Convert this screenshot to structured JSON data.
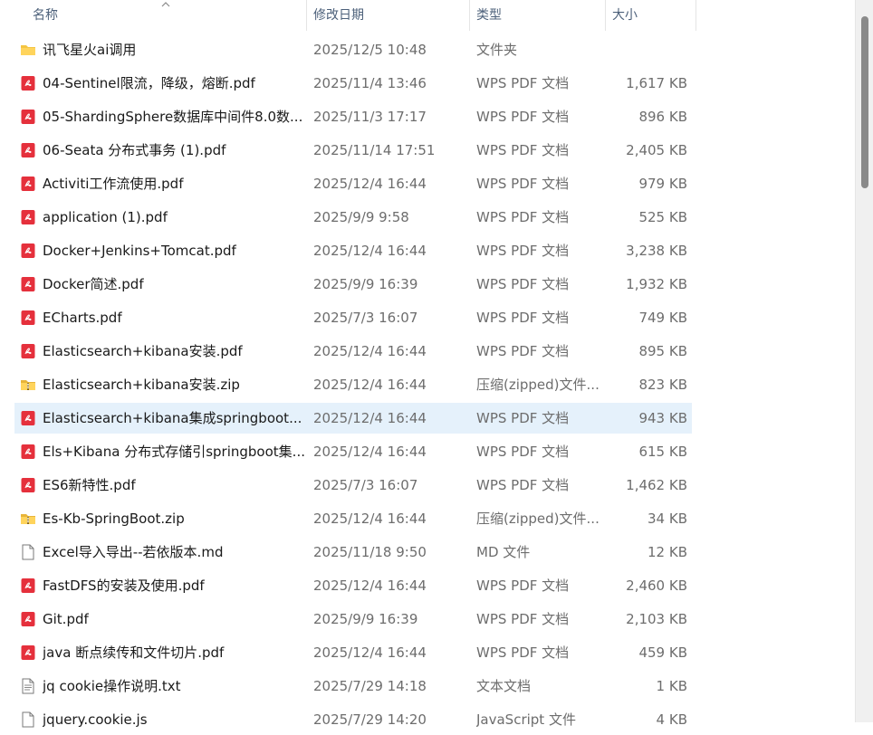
{
  "columns": {
    "name": "名称",
    "date": "修改日期",
    "type": "类型",
    "size": "大小"
  },
  "files": [
    {
      "name": "讯飞星火ai调用",
      "date": "2025/12/5 10:48",
      "type": "文件夹",
      "size": "",
      "icon": "folder-icon"
    },
    {
      "name": "04-Sentinel限流，降级，熔断.pdf",
      "date": "2025/11/4 13:46",
      "type": "WPS PDF 文档",
      "size": "1,617 KB",
      "icon": "pdf-icon"
    },
    {
      "name": "05-ShardingSphere数据库中间件8.0数...",
      "date": "2025/11/3 17:17",
      "type": "WPS PDF 文档",
      "size": "896 KB",
      "icon": "pdf-icon"
    },
    {
      "name": "06-Seata 分布式事务 (1).pdf",
      "date": "2025/11/14 17:51",
      "type": "WPS PDF 文档",
      "size": "2,405 KB",
      "icon": "pdf-icon"
    },
    {
      "name": "Activiti工作流使用.pdf",
      "date": "2025/12/4 16:44",
      "type": "WPS PDF 文档",
      "size": "979 KB",
      "icon": "pdf-icon"
    },
    {
      "name": "application (1).pdf",
      "date": "2025/9/9 9:58",
      "type": "WPS PDF 文档",
      "size": "525 KB",
      "icon": "pdf-icon"
    },
    {
      "name": "Docker+Jenkins+Tomcat.pdf",
      "date": "2025/12/4 16:44",
      "type": "WPS PDF 文档",
      "size": "3,238 KB",
      "icon": "pdf-icon"
    },
    {
      "name": "Docker简述.pdf",
      "date": "2025/9/9 16:39",
      "type": "WPS PDF 文档",
      "size": "1,932 KB",
      "icon": "pdf-icon"
    },
    {
      "name": "ECharts.pdf",
      "date": "2025/7/3 16:07",
      "type": "WPS PDF 文档",
      "size": "749 KB",
      "icon": "pdf-icon"
    },
    {
      "name": "Elasticsearch+kibana安装.pdf",
      "date": "2025/12/4 16:44",
      "type": "WPS PDF 文档",
      "size": "895 KB",
      "icon": "pdf-icon"
    },
    {
      "name": "Elasticsearch+kibana安装.zip",
      "date": "2025/12/4 16:44",
      "type": "压缩(zipped)文件...",
      "size": "823 KB",
      "icon": "zip-icon"
    },
    {
      "name": "Elasticsearch+kibana集成springboot...",
      "date": "2025/12/4 16:44",
      "type": "WPS PDF 文档",
      "size": "943 KB",
      "icon": "pdf-icon",
      "selected": true
    },
    {
      "name": "Els+Kibana 分布式存储引springboot集...",
      "date": "2025/12/4 16:44",
      "type": "WPS PDF 文档",
      "size": "615 KB",
      "icon": "pdf-icon"
    },
    {
      "name": "ES6新特性.pdf",
      "date": "2025/7/3 16:07",
      "type": "WPS PDF 文档",
      "size": "1,462 KB",
      "icon": "pdf-icon"
    },
    {
      "name": "Es-Kb-SpringBoot.zip",
      "date": "2025/12/4 16:44",
      "type": "压缩(zipped)文件...",
      "size": "34 KB",
      "icon": "zip-icon"
    },
    {
      "name": "Excel导入导出--若依版本.md",
      "date": "2025/11/18 9:50",
      "type": "MD 文件",
      "size": "12 KB",
      "icon": "file-icon"
    },
    {
      "name": "FastDFS的安装及使用.pdf",
      "date": "2025/12/4 16:44",
      "type": "WPS PDF 文档",
      "size": "2,460 KB",
      "icon": "pdf-icon"
    },
    {
      "name": "Git.pdf",
      "date": "2025/9/9 16:39",
      "type": "WPS PDF 文档",
      "size": "2,103 KB",
      "icon": "pdf-icon"
    },
    {
      "name": "java 断点续传和文件切片.pdf",
      "date": "2025/12/4 16:44",
      "type": "WPS PDF 文档",
      "size": "459 KB",
      "icon": "pdf-icon"
    },
    {
      "name": "jq cookie操作说明.txt",
      "date": "2025/7/29 14:18",
      "type": "文本文档",
      "size": "1 KB",
      "icon": "txt-icon"
    },
    {
      "name": "jquery.cookie.js",
      "date": "2025/7/29 14:20",
      "type": "JavaScript 文件",
      "size": "4 KB",
      "icon": "js-icon"
    }
  ]
}
